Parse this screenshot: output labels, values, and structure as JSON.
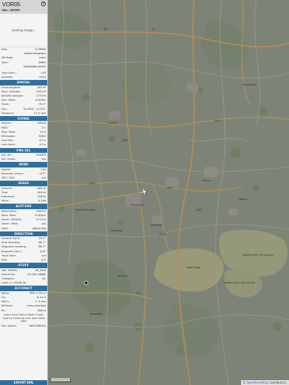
{
  "aircraft": {
    "callsign": "VOR05",
    "hex": "Hex : 4070F4",
    "photo_status": "Loading image..."
  },
  "header_rows": [
    {
      "key": "Reg.:",
      "val": "G-GBAS"
    },
    {
      "key": "",
      "val": "United Kingdom"
    },
    {
      "key": "DB flags:",
      "val": "none"
    },
    {
      "key": "Type:",
      "val": "DA62"
    },
    {
      "key": "",
      "val": "DIAMOND DA-62"
    }
  ],
  "type_rows": [
    {
      "key": "Type Desc.:",
      "val": "L2P"
    },
    {
      "key": "Squawk:",
      "val": "1024"
    }
  ],
  "sections": [
    {
      "title": "SPATIAL",
      "rows": [
        {
          "key": "Groundspeed:",
          "val": "165 kt"
        },
        {
          "key": "Baro. Altitude:",
          "val": "2425 ft"
        },
        {
          "key": "WGS84 altitude:",
          "val": "2775 ft"
        },
        {
          "key": "Vert. Rate:",
          "val": "0 ft/min"
        },
        {
          "key": "Track:",
          "val": "79.2°"
        },
        {
          "key": "Pos.:",
          "val": "51.394°, -2.212°"
        },
        {
          "key": "Distance:",
          "val": "11.5 nmi"
        }
      ]
    },
    {
      "title": "SIGNAL",
      "rows": [
        {
          "key": "Source:",
          "val": "ADS-B"
        },
        {
          "key": "RSSI:",
          "val": "-7.1"
        },
        {
          "key": "Msg. Rate:",
          "val": "13.5"
        },
        {
          "key": "Messages:",
          "val": "6454"
        },
        {
          "key": "Last Pos.:",
          "val": "0.3 s"
        },
        {
          "key": "Last Seen:",
          "val": "0.3 s"
        }
      ]
    },
    {
      "title": "FMS SEL",
      "rows": [
        {
          "key": "Sel. Alt.:",
          "val": "2016 ft"
        },
        {
          "key": "Sel. Head.:",
          "val": "n/a"
        }
      ]
    },
    {
      "title": "WIND",
      "rows": [
        {
          "key": "Speed:",
          "val": "5 kt"
        },
        {
          "key": "Direction (from):",
          "val": "157°"
        },
        {
          "key": "TAT / OAT:",
          "val": "n/a"
        }
      ]
    },
    {
      "title": "SPEED",
      "rows": [
        {
          "key": "Ground:",
          "val": "165 kt"
        },
        {
          "key": "True:",
          "val": "164 kt"
        },
        {
          "key": "Indicated:",
          "val": "156 kt"
        },
        {
          "key": "Mach:",
          "val": "0.248"
        }
      ]
    },
    {
      "title": "ALTITUDE",
      "rows": [
        {
          "key": "Barometric:",
          "val": "2425 ft"
        },
        {
          "key": "Baro. Rate:",
          "val": "0 ft/min"
        },
        {
          "key": "Geom. WGS84:",
          "val": "2775 ft"
        },
        {
          "key": "Geom. Rate:",
          "val": "n/a"
        },
        {
          "key": "QNH:",
          "val": "996.8 hPa"
        }
      ]
    },
    {
      "title": "DIRECTION",
      "rows": [
        {
          "key": "Ground Track:",
          "val": "79.2°"
        },
        {
          "key": "True Heading:",
          "val": "80.7°"
        },
        {
          "key": "Magnetic Heading:",
          "val": "80.7°"
        },
        {
          "key": "Magnetic Decl.:",
          "val": "0.0°"
        },
        {
          "key": "Track Rate:",
          "val": "n/a"
        },
        {
          "key": "Roll:",
          "val": "-0.2"
        }
      ]
    },
    {
      "title": "STUFF",
      "rows": [
        {
          "key": "Nav. Modes:",
          "val": "alt_hold"
        },
        {
          "key": "ADS-B Ver.:",
          "val": "v2 (DO-260B)"
        },
        {
          "key": "Category:",
          "val": "A1"
        },
        {
          "key": "Light (< 15500 lb)",
          "val": ""
        }
      ]
    },
    {
      "title": "ACCURACY",
      "rows": [
        {
          "key": "NACp:",
          "val": "EPU < 30 m"
        },
        {
          "key": "SIL:",
          "val": "≤ 1e-5"
        },
        {
          "key": "NACv:",
          "val": "< 3 m/s"
        },
        {
          "key": "NICbaro:",
          "val": "cross-checked"
        },
        {
          "key": "Rc:",
          "val": "186 m"
        }
      ]
    }
  ],
  "learn_more": "Learn more about Mode S data type by hovering over each data label",
  "pos_epoch": {
    "key": "Pos. epoch:",
    "val": "1691598103"
  },
  "export_label": "EXPORT KML",
  "map": {
    "places": [
      {
        "name": "Chippenham",
        "kind": "town"
      },
      {
        "name": "Melksham",
        "kind": "town"
      },
      {
        "name": "Devizes",
        "kind": "town"
      },
      {
        "name": "Calne",
        "kind": "town"
      },
      {
        "name": "Trowbridge",
        "kind": "town"
      },
      {
        "name": "Warminster",
        "kind": "town"
      },
      {
        "name": "Bradford-on-Avon",
        "kind": "town"
      },
      {
        "name": "Westbury",
        "kind": "town"
      },
      {
        "name": "Corsham",
        "kind": "town"
      },
      {
        "name": "Pewsey",
        "kind": "town"
      },
      {
        "name": "Marlborough",
        "kind": "town"
      },
      {
        "name": "Salisbury Plain Training Area",
        "kind": "area"
      },
      {
        "name": "Imber Range",
        "kind": "area"
      },
      {
        "name": "Sandway Plain Training Area",
        "kind": "area"
      }
    ],
    "roads": [
      "A4",
      "A350",
      "A36",
      "A361",
      "A342",
      "A365",
      "A3102",
      "M4"
    ],
    "attribution_prefix": "©",
    "attribution_link": "OpenStreetMap",
    "attribution_suffix": "contributors."
  },
  "colors": {
    "section_header": "#2e6f9e",
    "map_base": "#7e8276",
    "track_line": "#d49a4a",
    "aircraft_icon": "#ffffff"
  }
}
